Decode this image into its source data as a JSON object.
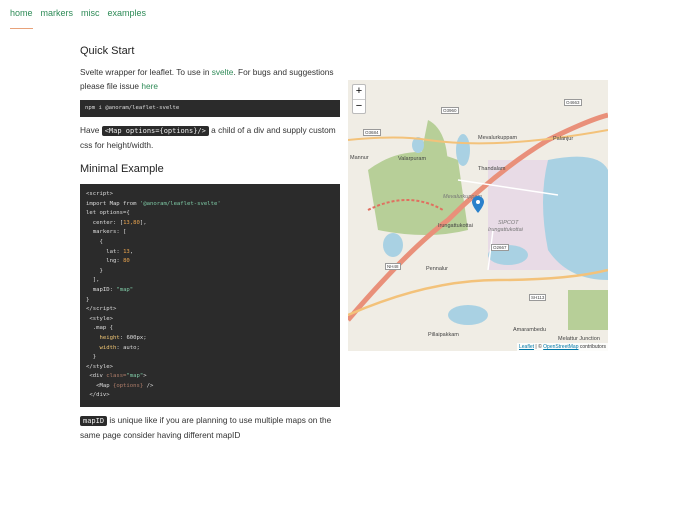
{
  "nav": {
    "items": [
      "home",
      "markers",
      "misc",
      "examples"
    ],
    "active": "home"
  },
  "quick_start": {
    "title": "Quick Start",
    "intro_before": "Svelte wrapper for leaflet. To use in ",
    "intro_link": "svelte",
    "intro_mid": ". For bugs and suggestions please file issue ",
    "intro_link2": "here",
    "install_cmd": "npm i @anoram/leaflet-svelte",
    "have_before": "Have ",
    "have_code": "<Map options={options}/>",
    "have_after": " a child of a div and supply custom css for height/width."
  },
  "minimal": {
    "title": "Minimal Example",
    "code_lines": [
      [
        "<script>"
      ],
      [
        "import Map from ",
        "'@anoram/leaflet-svelte'"
      ],
      [
        "let options={"
      ],
      [
        "  center: [",
        "13,80",
        "],"
      ],
      [
        "  markers: ["
      ],
      [
        "    {"
      ],
      [
        "      lat: ",
        "13",
        ","
      ],
      [
        "      lng: ",
        "80"
      ],
      [
        "    }"
      ],
      [
        "  ],"
      ],
      [
        "  mapID: ",
        "\"map\""
      ],
      [
        "}"
      ],
      [
        "</script>"
      ],
      [
        " <style>"
      ],
      [
        "  .map {"
      ],
      [
        "    height",
        ": 600px;"
      ],
      [
        "    width",
        ": auto;"
      ],
      [
        "  }"
      ],
      [
        "</style>"
      ],
      [
        " <div ",
        "class=",
        "\"map\"",
        ">"
      ],
      [
        "   <Map ",
        "{options}",
        " />"
      ],
      [
        " </div>"
      ]
    ],
    "note_code": "mapID",
    "note_text": " is unique like if you are planning to use multiple maps on the same page consider having different mapID"
  },
  "map": {
    "zoom_in": "+",
    "zoom_out": "−",
    "labels": [
      "Mevalurkuppam",
      "Thandalam",
      "Valarpuram",
      "Mannur",
      "Irungattukottai",
      "SIPCOT",
      "Irungattukottai",
      "Pennalur",
      "Pillaipakkam",
      "Amarambedu",
      "Palanjur",
      "Mevalurkuppam",
      "Melattur Junction"
    ],
    "refs": [
      "O3960",
      "O4663",
      "O3684",
      "O2667",
      "NH48",
      "SH113"
    ],
    "attribution_link": "Leaflet",
    "attribution_sep": " | © ",
    "attribution_osm": "OpenStreetMap",
    "attribution_tail": " contributors",
    "marker_color": "#2a81cb"
  }
}
